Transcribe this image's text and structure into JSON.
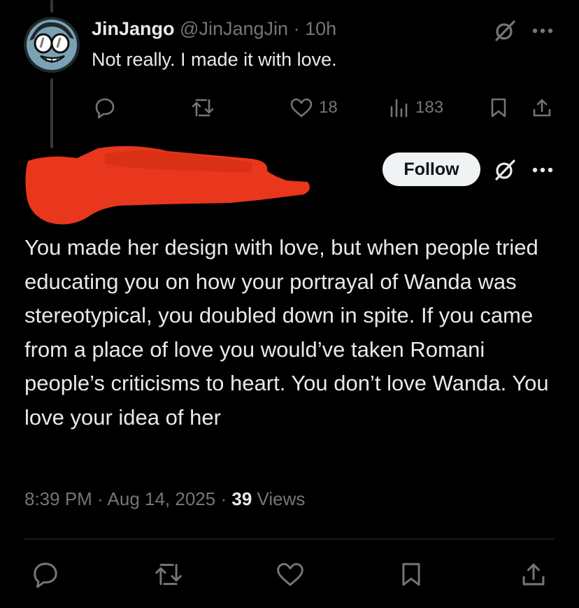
{
  "reply": {
    "display_name": "JinJango",
    "handle": "@JinJangJin",
    "separator": "·",
    "time_ago": "10h",
    "text": "Not really. I made it with love.",
    "likes": "18",
    "views": "183"
  },
  "main_post": {
    "follow_label": "Follow",
    "text": "You made her design with love, but when people tried educating you on how your portrayal of Wanda was stereotypical, you doubled down in spite. If you came from a place of love you would’ve taken Romani people’s criticisms to heart. You don’t love Wanda. You love your idea of her",
    "time": "8:39 PM",
    "sep1": "·",
    "date": "Aug 14, 2025",
    "sep2": "·",
    "views_count": "39",
    "views_label": "Views"
  },
  "icons": {
    "reply": "reply-icon",
    "repost": "repost-icon",
    "like": "heart-icon",
    "views": "views-icon",
    "bookmark": "bookmark-icon",
    "share": "share-icon",
    "grok": "grok-icon",
    "more": "more-icon"
  },
  "colors": {
    "background": "#000000",
    "text": "#e7e9ea",
    "muted": "#71767b",
    "redaction": "#e8371c",
    "follow_bg": "#eff3f4"
  }
}
